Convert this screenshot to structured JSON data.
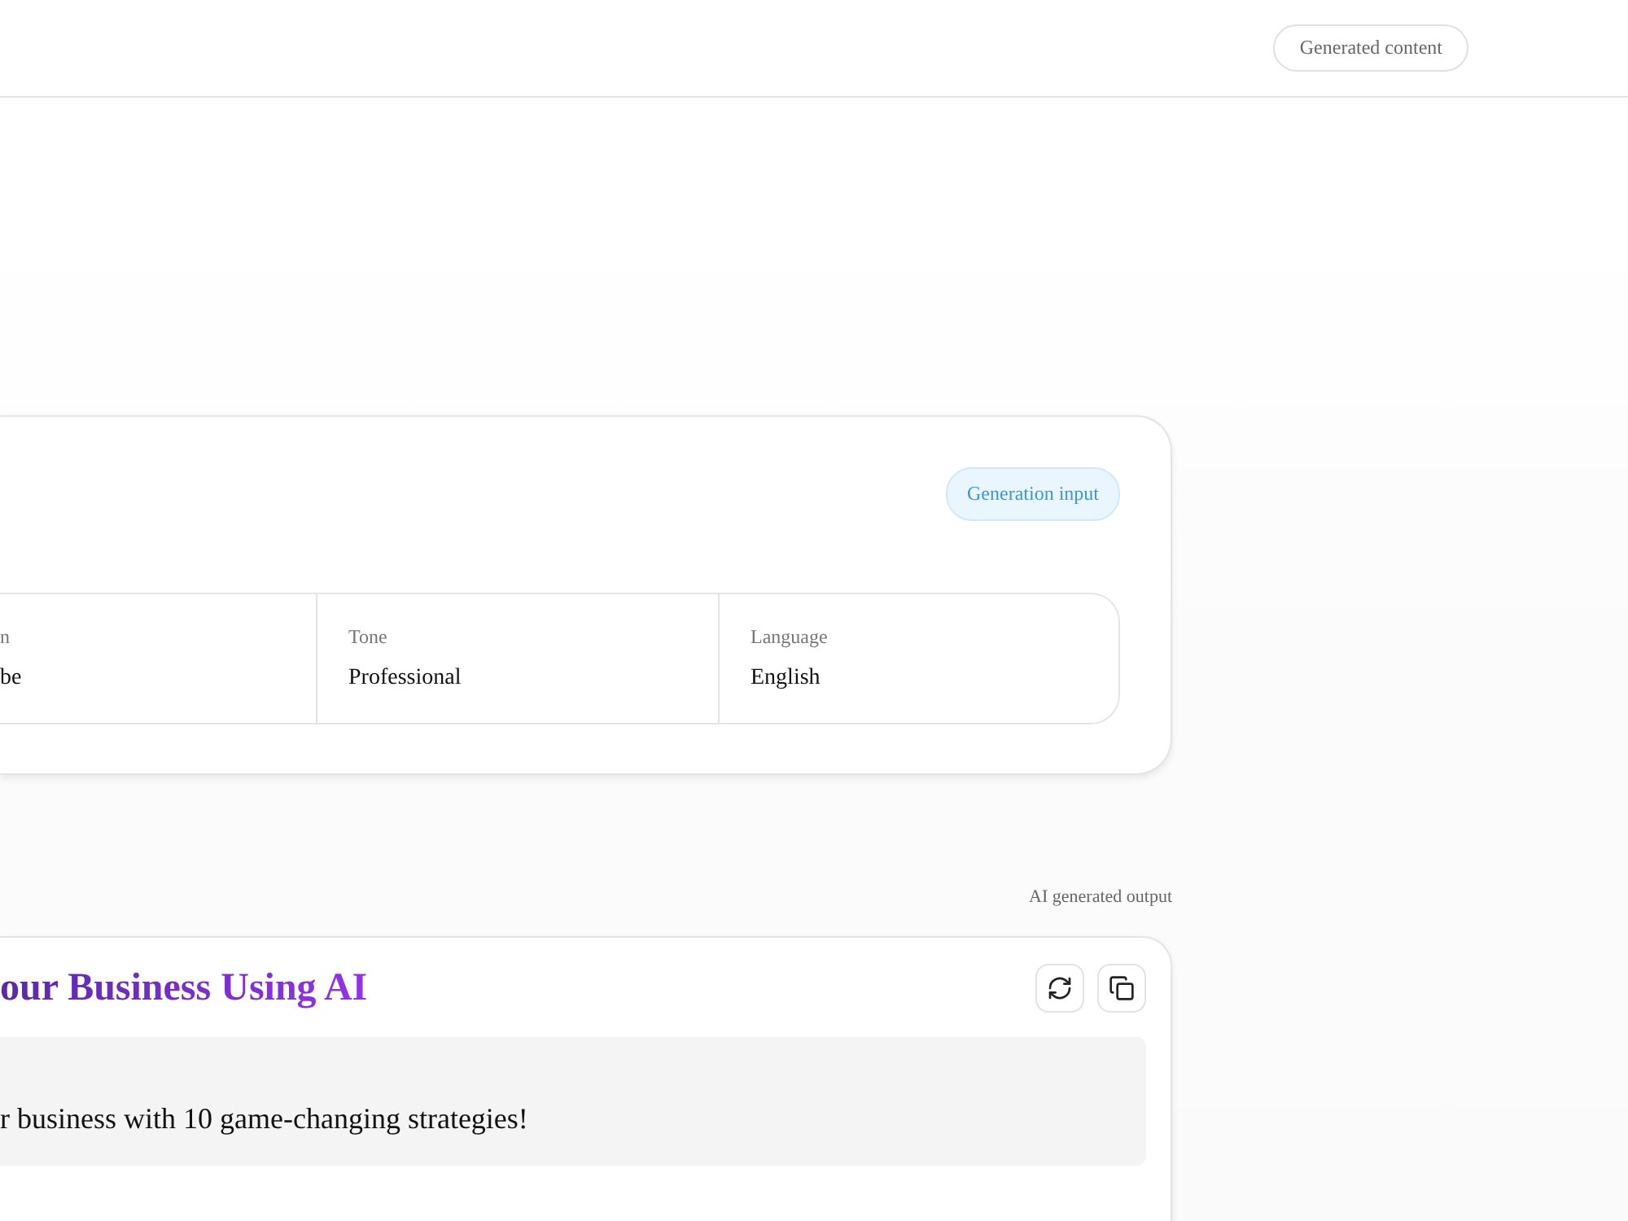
{
  "header": {
    "badge": "Generated content"
  },
  "input_card": {
    "badge": "Generation input",
    "fields": [
      {
        "label": "n",
        "value": "be"
      },
      {
        "label": "Tone",
        "value": "Professional"
      },
      {
        "label": "Language",
        "value": "English"
      }
    ]
  },
  "output": {
    "caption": "AI generated output",
    "title": "our Business Using AI",
    "text": "r business with 10 game-changing strategies!"
  }
}
